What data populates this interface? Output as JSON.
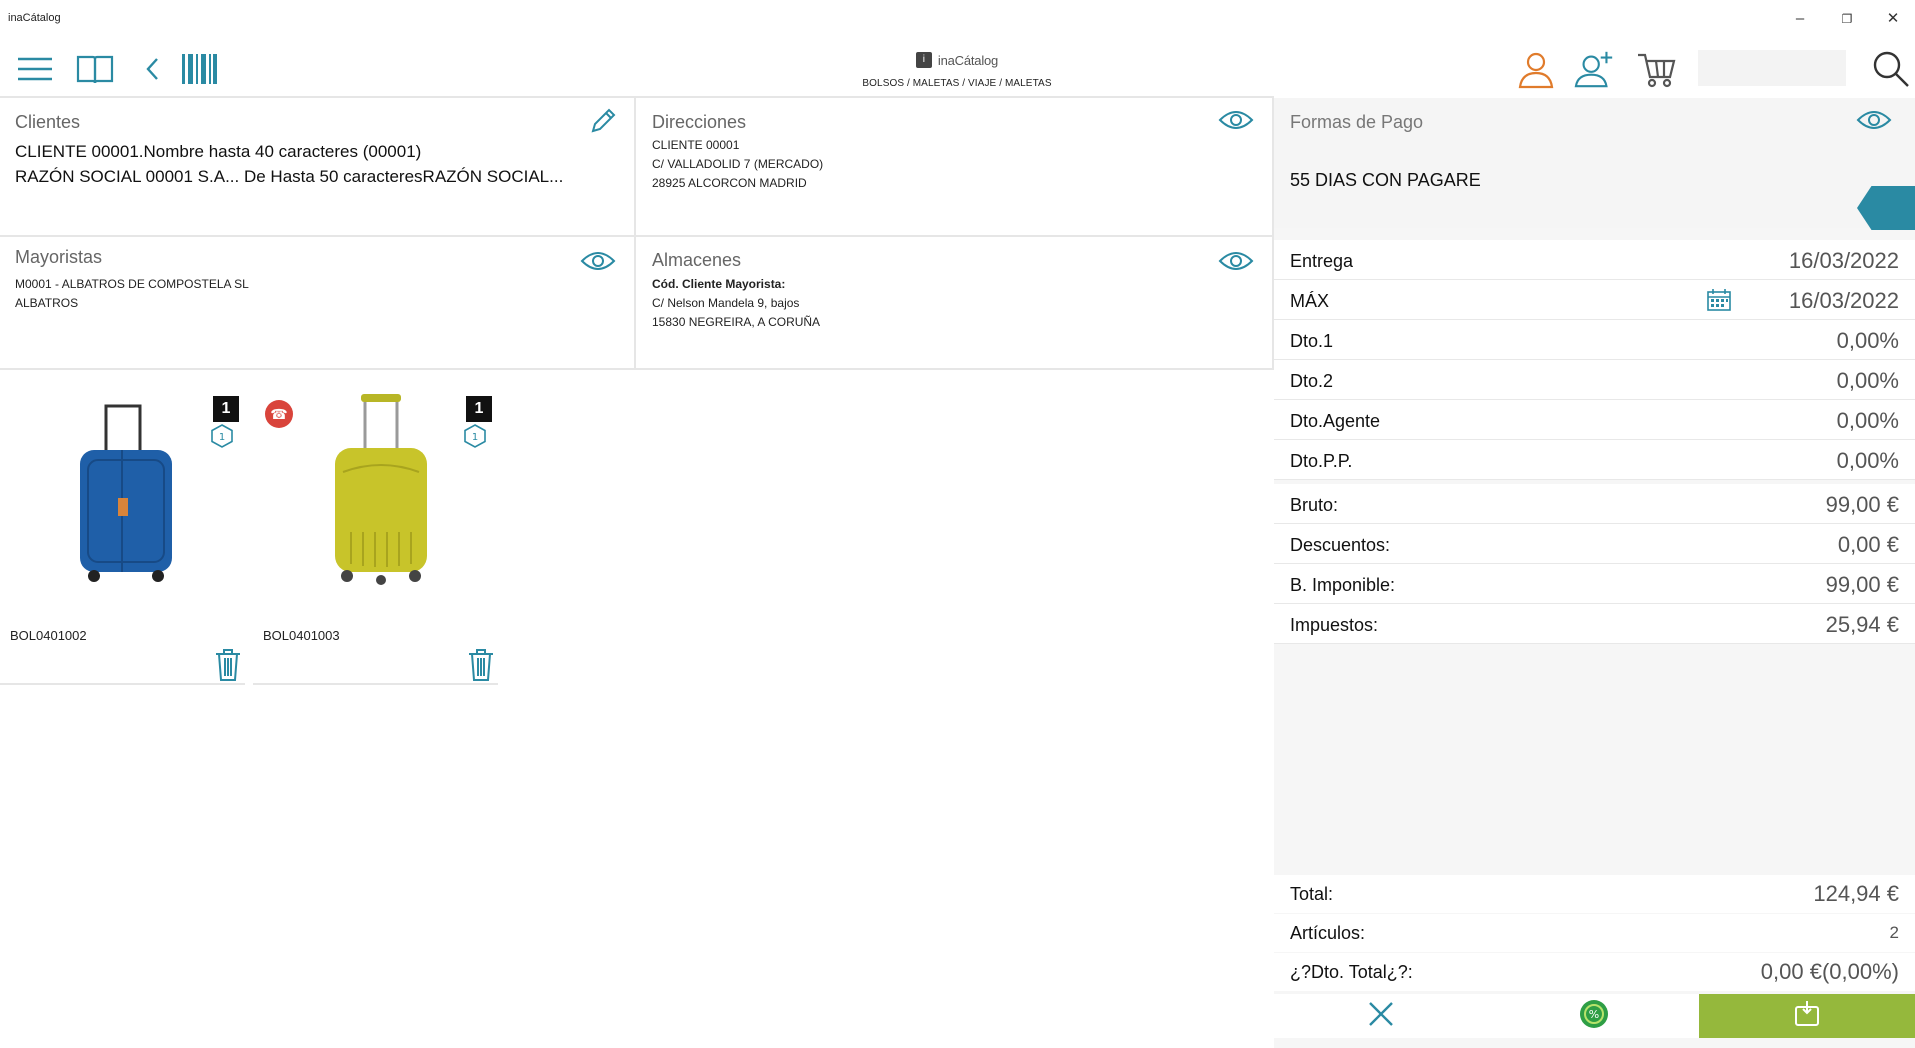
{
  "window": {
    "title": "inaCátalog",
    "minimize": "–",
    "restore": "❐",
    "close": "✕"
  },
  "toolbar": {
    "brand_name": "inaCátalog",
    "breadcrumb": "BOLSOS / MALETAS / VIAJE / MALETAS",
    "search_value": ""
  },
  "clientes": {
    "title": "Clientes",
    "line1": "CLIENTE 00001.Nombre hasta 40 caracteres (00001)",
    "line2": "RAZÓN SOCIAL  00001 S.A... De  Hasta 50 caracteresRAZÓN SOCIAL..."
  },
  "direcciones": {
    "title": "Direcciones",
    "line1": "CLIENTE 00001",
    "line2": "C/ VALLADOLID 7 (MERCADO)",
    "line3": "28925 ALCORCON MADRID"
  },
  "mayoristas": {
    "title": "Mayoristas",
    "line1": "M0001 - ALBATROS DE COMPOSTELA SL",
    "line2": "ALBATROS"
  },
  "almacenes": {
    "title": "Almacenes",
    "line1": "Cód. Cliente Mayorista:",
    "line2": "C/ Nelson Mandela 9, bajos",
    "line3": "15830 NEGREIRA, A CORUÑA"
  },
  "pago": {
    "title": "Formas de Pago",
    "value": "55 DIAS CON PAGARE"
  },
  "summary": [
    {
      "label": "Entrega",
      "value": "16/03/2022"
    },
    {
      "label": "MÁX",
      "value": "16/03/2022"
    },
    {
      "label": "Dto.1",
      "value": "0,00%"
    },
    {
      "label": "Dto.2",
      "value": "0,00%"
    },
    {
      "label": "Dto.Agente",
      "value": "0,00%"
    },
    {
      "label": "Dto.P.P.",
      "value": "0,00%"
    },
    {
      "label": "Bruto:",
      "value": "99,00 €"
    },
    {
      "label": "Descuentos:",
      "value": "0,00 €"
    },
    {
      "label": "B. Imponible:",
      "value": "99,00 €"
    },
    {
      "label": "Impuestos:",
      "value": "25,94 €"
    }
  ],
  "totals": [
    {
      "label": "Total:",
      "value": "124,94 €"
    },
    {
      "label": "Artículos:",
      "value": "2"
    },
    {
      "label": "¿?Dto. Total¿?:",
      "value": "0,00 €(0,00%)"
    }
  ],
  "products": [
    {
      "sku": "BOL0401002",
      "qty": "1",
      "hex_label": "1",
      "color": "#1f5fa8"
    },
    {
      "sku": "BOL0401003",
      "qty": "1",
      "hex_label": "1",
      "color": "#c8c42a"
    }
  ],
  "colors": {
    "accent": "#2a8aa3",
    "confirm": "#95b83c",
    "promo": "#d9443b"
  },
  "icons": {
    "menu": "hamburger-icon",
    "catalog": "book-icon",
    "back": "chevron-left-icon",
    "barcode": "barcode-icon",
    "user": "user-icon",
    "add_user": "add-user-icon",
    "cart": "cart-icon",
    "search": "search-icon",
    "edit": "pencil-icon",
    "view": "eye-icon",
    "calendar": "calendar-icon",
    "delete": "trash-icon",
    "cancel": "close-icon",
    "discount": "discount-icon",
    "confirm": "confirm-order-icon"
  }
}
